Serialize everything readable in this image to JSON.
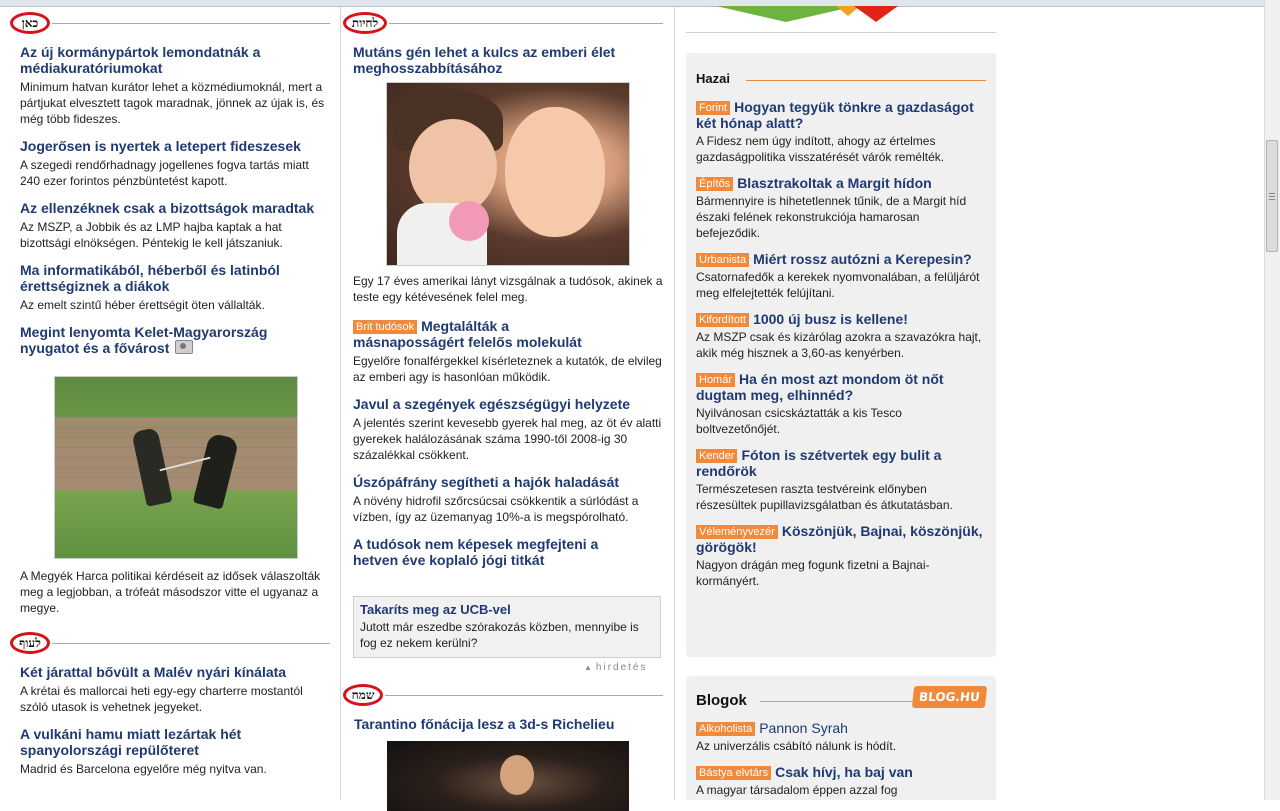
{
  "sections": {
    "left_top_tag": "כאן",
    "left_bottom_tag": "לעוף",
    "mid_top_tag": "לחיות",
    "mid_bottom_tag": "שמח"
  },
  "left_articles": [
    {
      "title": "Az új kormánypártok lemondatnák a médiakuratóriumokat",
      "lead": "Minimum hatvan kurátor lehet a közmédiumoknál, mert a pártjukat elvesztett tagok maradnak, jönnek az újak is, és még több fideszes."
    },
    {
      "title": "Jogerősen is nyertek a letepert fideszesek",
      "lead": "A szegedi rendőrhadnagy jogellenes fogva tartás miatt 240 ezer forintos pénzbüntetést kapott."
    },
    {
      "title": "Az ellenzéknek csak a bizottságok maradtak",
      "lead": "Az MSZP, a Jobbik és az LMP hajba kaptak a hat bizottsági elnökségen. Péntekig le kell játszaniuk."
    },
    {
      "title": "Ma informatikából, héberből és latinból érettségiznek a diákok",
      "lead": "Az emelt szintű héber érettségit öten vállalták."
    },
    {
      "title": "Megint lenyomta Kelet-Magyarország nyugatot és a fővárost",
      "lead": "A Megyék Harca politikai kérdéseit az idősek válaszolták meg a legjobban, a trófeát másodszor vitte el ugyanaz a megye."
    }
  ],
  "left_bottom_articles": [
    {
      "title": "Két járattal bővült a Malév nyári kínálata",
      "lead": "A krétai és mallorcai heti egy-egy charterre mostantól szóló utasok is vehetnek jegyeket."
    },
    {
      "title": "A vulkáni hamu miatt lezártak hét spanyolországi repülőteret",
      "lead": "Madrid és Barcelona egyelőre még nyitva van."
    }
  ],
  "mid_articles": [
    {
      "title": "Mutáns gén lehet a kulcs az emberi élet meghosszabbításához",
      "lead": "Egy 17 éves amerikai lányt vizsgálnak a tudósok, akinek a teste egy kétévesének felel meg."
    },
    {
      "tag": "Brit tudósok",
      "title": "Megtalálták a másnaposságért felelős molekulát",
      "lead": "Egyelőre fonalférgekkel kísérleteznek a kutatók, de elvileg az emberi agy is hasonlóan működik."
    },
    {
      "title": "Javul a szegények egészségügyi helyzete",
      "lead": "A jelentés szerint kevesebb gyerek hal meg, az öt év alatti gyerekek halálozásának száma 1990-től 2008-ig 30 százalékkal csökkent."
    },
    {
      "title": "Úszópáfrány segítheti a hajók haladását",
      "lead": "A növény hidrofil szőrcsúcsai csökkentik a súrlódást a vízben, így az üzemanyag 10%-a is megspórolható."
    },
    {
      "title": "A tudósok nem képesek megfejteni a hetven éve koplaló jógi titkát"
    }
  ],
  "ad": {
    "title": "Takaríts meg az UCB-vel",
    "text": "Jutott már eszedbe szórakozás közben, mennyibe is fog ez nekem kerülni?",
    "label": "hirdetés"
  },
  "mid_bottom_article": {
    "title": "Tarantino főnácija lesz a 3d-s Richelieu"
  },
  "hazai": {
    "title": "Hazai",
    "articles": [
      {
        "tag": "Forint",
        "title": "Hogyan tegyük tönkre a gazdaságot két hónap alatt?",
        "lead": "A Fidesz nem úgy indított, ahogy az értelmes gazdaságpolitika visszatérését várók remélték."
      },
      {
        "tag": "Építős",
        "title": "Blasztrakoltak a Margit hídon",
        "lead": "Bármennyire is hihetetlennek tűnik, de a Margit híd északi felének rekonstrukciója hamarosan befejeződik."
      },
      {
        "tag": "Urbanista",
        "title": "Miért rossz autózni a Kerepesin?",
        "lead": "Csatornafedők a kerekek nyomvonalában, a felüljárót meg elfelejtették felújítani."
      },
      {
        "tag": "Kifordított",
        "title": "1000 új busz is kellene!",
        "lead": "Az MSZP csak és kizárólag azokra a szavazókra hajt, akik még hisznek a 3,60-as kenyérben."
      },
      {
        "tag": "Homár",
        "title": "Ha én most azt mondom öt nőt dugtam meg, elhinnéd?",
        "lead": "Nyilvánosan csicskáztatták a kis Tesco boltvezetőnőjét."
      },
      {
        "tag": "Kender",
        "title": "Fóton is szétvertek egy bulit a rendőrök",
        "lead": "Természetesen raszta testvéreink előnyben részesültek pupillavizsgálatban és átkutatásban."
      },
      {
        "tag": "Véleményvezér",
        "title": "Köszönjük, Bajnai, köszönjük, görögök!",
        "lead": "Nagyon drágán meg fogunk fizetni a Bajnai-kormányért."
      }
    ]
  },
  "blogok": {
    "title": "Blogok",
    "logo": "BLOG.HU",
    "articles": [
      {
        "tag": "Alkoholista",
        "title": "Pannon Syrah",
        "lead": "Az univerzális csábító nálunk is hódít."
      },
      {
        "tag": "Bástya elvtárs",
        "title": "Csak hívj, ha baj van",
        "lead": "A magyar társadalom éppen azzal fog"
      }
    ]
  },
  "colors": {
    "link": "#1f3a73",
    "tag_bg": "#f08a3a",
    "ring": "#d8111b"
  }
}
